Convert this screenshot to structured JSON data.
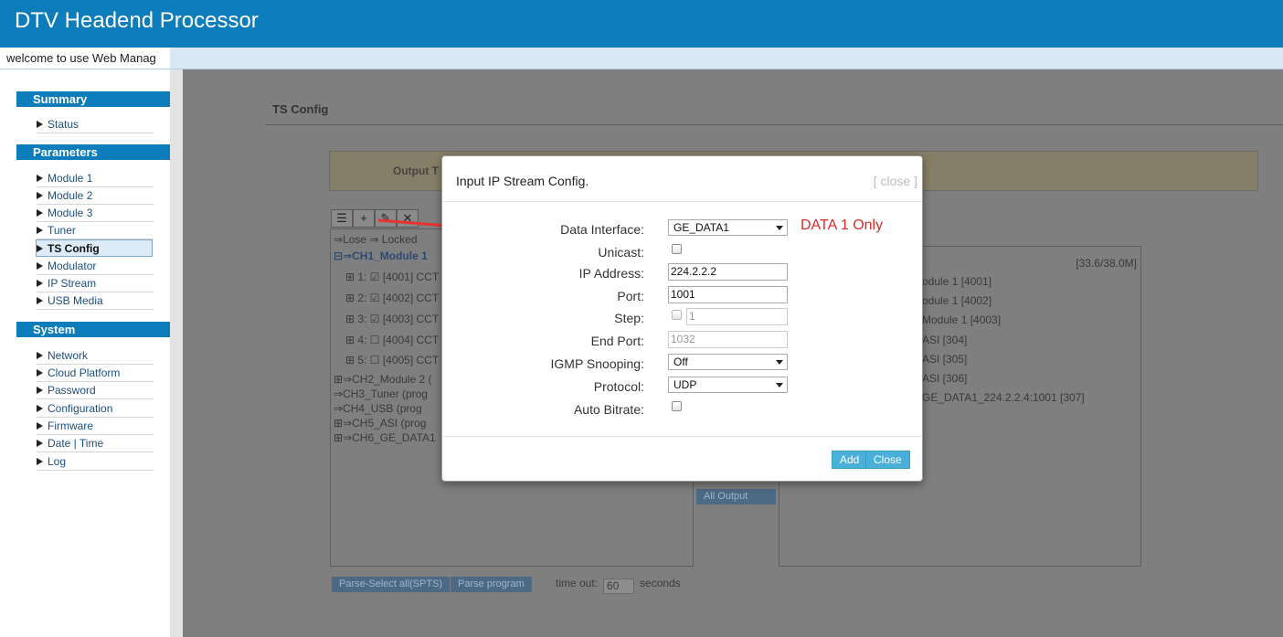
{
  "app": {
    "title": "DTV Headend Processor",
    "welcome": "welcome to use Web Manag"
  },
  "sidebar": {
    "sections": [
      {
        "title": "Summary",
        "items": [
          "Status"
        ]
      },
      {
        "title": "Parameters",
        "items": [
          "Module 1",
          "Module 2",
          "Module 3",
          "Tuner",
          "TS Config",
          "Modulator",
          "IP Stream",
          "USB Media"
        ]
      },
      {
        "title": "System",
        "items": [
          "Network",
          "Cloud Platform",
          "Password",
          "Configuration",
          "Firmware",
          "Date | Time",
          "Log"
        ]
      }
    ],
    "active": "TS Config"
  },
  "main": {
    "section_title": "TS Config",
    "output_label": "Output T",
    "toolbar": [
      "☰",
      "+",
      "✎",
      "✕"
    ],
    "legend": "⇒Lose  ⇒ Locked",
    "tree": [
      {
        "text": "⊟⇒CH1_Module 1",
        "style": "blue"
      },
      {
        "text": "⊞ 1: ☑ [4001] CCT",
        "style": ""
      },
      {
        "text": "⊞ 2: ☑ [4002] CCT",
        "style": ""
      },
      {
        "text": "⊞ 3: ☑ [4003] CCT",
        "style": ""
      },
      {
        "text": "⊞ 4: ☐ [4004] CCT",
        "style": ""
      },
      {
        "text": "⊞ 5: ☐ [4005] CCT",
        "style": ""
      },
      {
        "text": "⊞⇒CH2_Module 2 (",
        "style": ""
      },
      {
        "text": "  ⇒CH3_Tuner (prog",
        "style": ""
      },
      {
        "text": "  ⇒CH4_USB (prog",
        "style": ""
      },
      {
        "text": "⊞⇒CH5_ASI (prog",
        "style": ""
      },
      {
        "text": "⊞⇒CH6_GE_DATA1",
        "style": ""
      }
    ],
    "right_header": "[33.6/38.0M]",
    "right_lines": [
      "odule 1 [4001]",
      "odule 1 [4002]",
      "Module 1 [4003]",
      "ASI [304]",
      "ASI [305]",
      "ASI [306]",
      "GE_DATA1_224.2.2.4:1001 [307]"
    ],
    "all_output": "All Output",
    "parse_all": "Parse-Select all(SPTS)",
    "parse_program": "Parse program",
    "timeout_label": "time out:",
    "timeout_value": "60",
    "timeout_unit": "seconds"
  },
  "modal": {
    "title": "Input IP Stream Config.",
    "close_link": "[ close ]",
    "fields": {
      "data_interface": {
        "label": "Data Interface:",
        "value": "GE_DATA1"
      },
      "unicast": {
        "label": "Unicast:"
      },
      "ip_address": {
        "label": "IP Address:",
        "value": "224.2.2.2"
      },
      "port": {
        "label": "Port:",
        "value": "1001"
      },
      "step": {
        "label": "Step:",
        "value": "1"
      },
      "end_port": {
        "label": "End Port:",
        "value": "1032"
      },
      "igmp": {
        "label": "IGMP Snooping:",
        "value": "Off"
      },
      "protocol": {
        "label": "Protocol:",
        "value": "UDP"
      },
      "auto_bitrate": {
        "label": "Auto Bitrate:"
      }
    },
    "add_label": "Add",
    "close_label": "Close"
  },
  "annotation": {
    "text": "DATA 1 Only",
    "color": "#d62b2b"
  },
  "colors": {
    "brand": "#0c7cba",
    "button": "#4ab0d9"
  }
}
